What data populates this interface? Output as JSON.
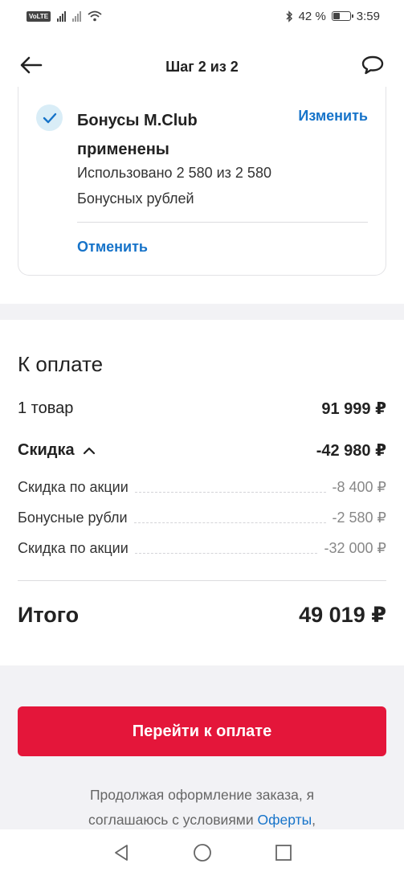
{
  "status_bar": {
    "volte": "VoLTE",
    "battery_percent": "42 %",
    "battery_level": 0.42,
    "time": "3:59"
  },
  "header": {
    "title": "Шаг 2 из 2",
    "back_icon": "arrow-left-icon",
    "chat_icon": "chat-bubble-icon"
  },
  "bonus": {
    "title": "Бонусы M.Club применены",
    "change_label": "Изменить",
    "used_text": "Использовано 2 580 из 2 580",
    "unit_text": "Бонусных рублей",
    "cancel_label": "Отменить",
    "check_icon": "check-circle-icon"
  },
  "summary": {
    "title": "К оплате",
    "items_label": "1 товар",
    "items_value": "91 999 ₽",
    "discount_label": "Скидка",
    "discount_value": "-42 980 ₽",
    "discount_icon": "chevron-up-icon",
    "discount_rows": [
      {
        "label": "Скидка по акции",
        "value": "-8 400 ₽"
      },
      {
        "label": "Бонусные рубли",
        "value": "-2 580 ₽"
      },
      {
        "label": "Скидка по акции",
        "value": "-32 000 ₽"
      }
    ],
    "total_label": "Итого",
    "total_value": "49 019 ₽"
  },
  "checkout": {
    "pay_button_label": "Перейти к оплате",
    "legal_line1": "Продолжая оформление заказа, я",
    "legal_line2_prefix": "соглашаюсь с условиями",
    "legal_link": "Оферты",
    "legal_line2_suffix": ","
  },
  "nav_bar": {
    "back_icon": "triangle-back-icon",
    "home_icon": "circle-home-icon",
    "recents_icon": "square-recents-icon"
  },
  "colors": {
    "accent_red": "#e4163a",
    "link_blue": "#1673c9",
    "check_bg": "#d9edf7",
    "separator_gray": "#f2f2f5"
  }
}
